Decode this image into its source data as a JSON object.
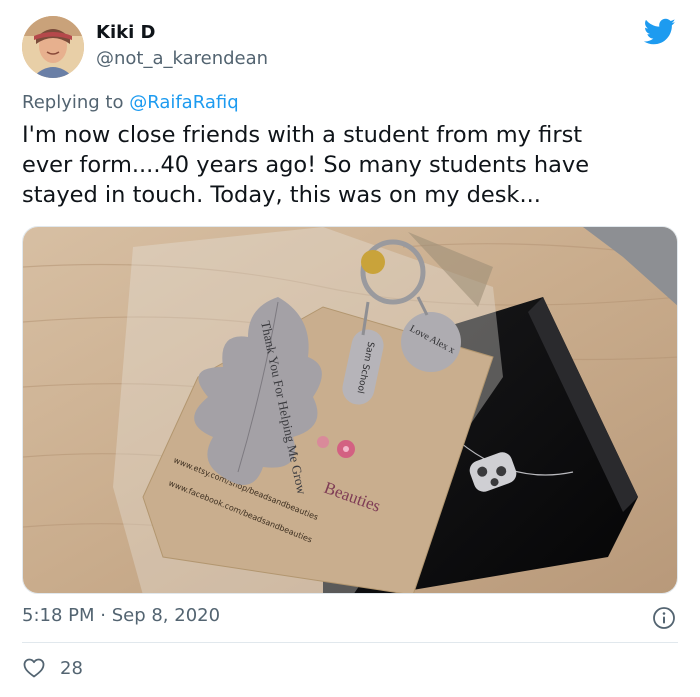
{
  "author": {
    "display_name": "Kiki D",
    "handle": "@not_a_karendean"
  },
  "reply": {
    "prefix": "Replying to ",
    "to": "@RaifaRafiq"
  },
  "tweet": {
    "text": "I'm now close friends with a student from my first\never form....40 years ago! So many students have\nstayed in touch. Today, this was on my desk..."
  },
  "photo": {
    "tag_leaf_text": "Thank You For Helping Me Grow",
    "tag_left_text": "Sam School",
    "tag_right_text": "Love Alex x",
    "card_brand": "Beauties",
    "card_etsy": "www.etsy.com/shop/beadsandbeauties",
    "card_facebook": "www.facebook.com/beadsandbeauties"
  },
  "meta": {
    "time": "5:18 PM",
    "separator": " · ",
    "date": "Sep 8, 2020"
  },
  "likes": {
    "count": "28"
  },
  "colors": {
    "accent": "#1d9bf0",
    "secondary_text": "#536471",
    "divider": "#e1e8ed"
  },
  "icons": {
    "brand": "twitter-bird-icon",
    "info": "info-icon",
    "like": "heart-outline-icon"
  }
}
